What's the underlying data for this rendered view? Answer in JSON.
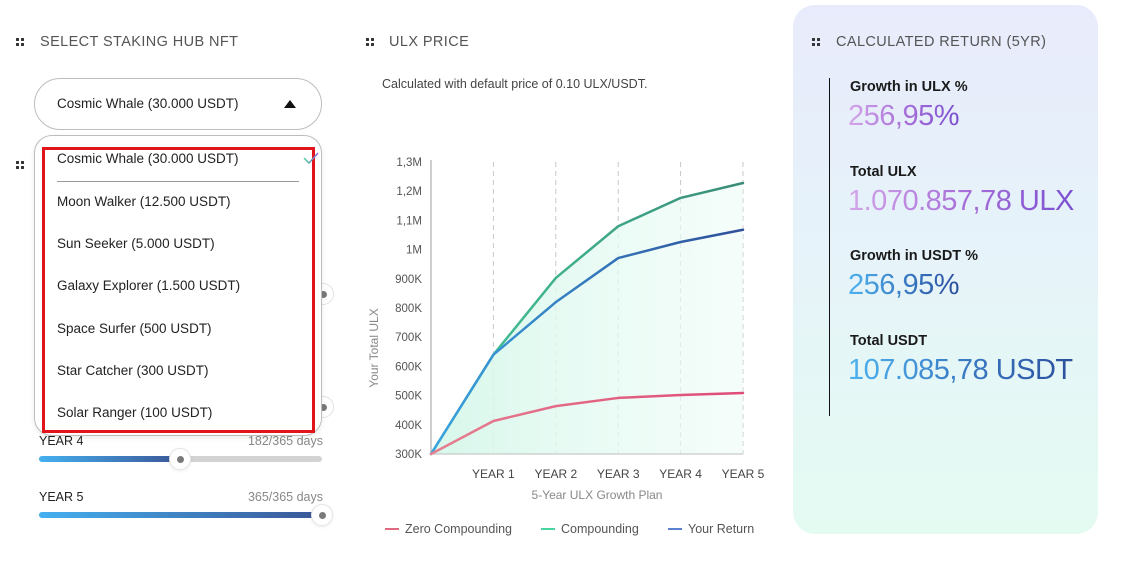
{
  "left_panel": {
    "title": "SELECT STAKING HUB NFT",
    "selected_nft": "Cosmic Whale (30.000 USDT)",
    "dropdown_open": true,
    "dropdown_options": [
      {
        "label": "Cosmic Whale (30.000 USDT)",
        "selected": true
      },
      {
        "label": "Moon Walker (12.500 USDT)",
        "selected": false
      },
      {
        "label": "Sun Seeker (5.000 USDT)",
        "selected": false
      },
      {
        "label": "Galaxy Explorer (1.500 USDT)",
        "selected": false
      },
      {
        "label": "Space Surfer (500 USDT)",
        "selected": false
      },
      {
        "label": "Star Catcher (300 USDT)",
        "selected": false
      },
      {
        "label": "Solar Ranger (100 USDT)",
        "selected": false
      }
    ],
    "sliders": [
      {
        "label": "YEAR 4",
        "days_text": "182/365 days",
        "value": 182,
        "max": 365
      },
      {
        "label": "YEAR 5",
        "days_text": "365/365 days",
        "value": 365,
        "max": 365
      }
    ]
  },
  "middle_panel": {
    "title": "ULX PRICE",
    "subtitle": "Calculated with default price of 0.10 ULX/USDT."
  },
  "chart_data": {
    "type": "line",
    "title": "",
    "xlabel": "5-Year ULX Growth Plan",
    "ylabel": "Your Total ULX",
    "x": [
      "",
      "YEAR 1",
      "YEAR 2",
      "YEAR 3",
      "YEAR 4",
      "YEAR 5"
    ],
    "x_tick_labels": [
      "YEAR 1",
      "YEAR 2",
      "YEAR 3",
      "YEAR 4",
      "YEAR 5"
    ],
    "y_tick_labels": [
      "300K",
      "400K",
      "500K",
      "600K",
      "700K",
      "800K",
      "900K",
      "1M",
      "1,1M",
      "1,2M",
      "1,3M"
    ],
    "ylim": [
      300000,
      1300000
    ],
    "grid": "vertical-dashed",
    "legend_position": "bottom",
    "series": [
      {
        "name": "Zero Compounding",
        "color": "#e06a80",
        "values": [
          300000,
          413000,
          464000,
          492000,
          502000,
          509000
        ]
      },
      {
        "name": "Compounding",
        "color": "#3fb88a",
        "values": [
          300000,
          640000,
          903000,
          1080000,
          1177000,
          1228000
        ]
      },
      {
        "name": "Your Return",
        "color": "#3a6fc0",
        "values": [
          300000,
          640000,
          820000,
          971000,
          1026000,
          1068000
        ]
      }
    ]
  },
  "right_panel": {
    "title": "CALCULATED RETURN (5YR)",
    "metrics": [
      {
        "label": "Growth in ULX %",
        "value": "256,95%"
      },
      {
        "label": "Total ULX",
        "value": "1.070.857,78 ULX"
      },
      {
        "label": "Growth in USDT %",
        "value": "256,95%"
      },
      {
        "label": "Total USDT",
        "value": "107.085,78 USDT"
      }
    ]
  }
}
